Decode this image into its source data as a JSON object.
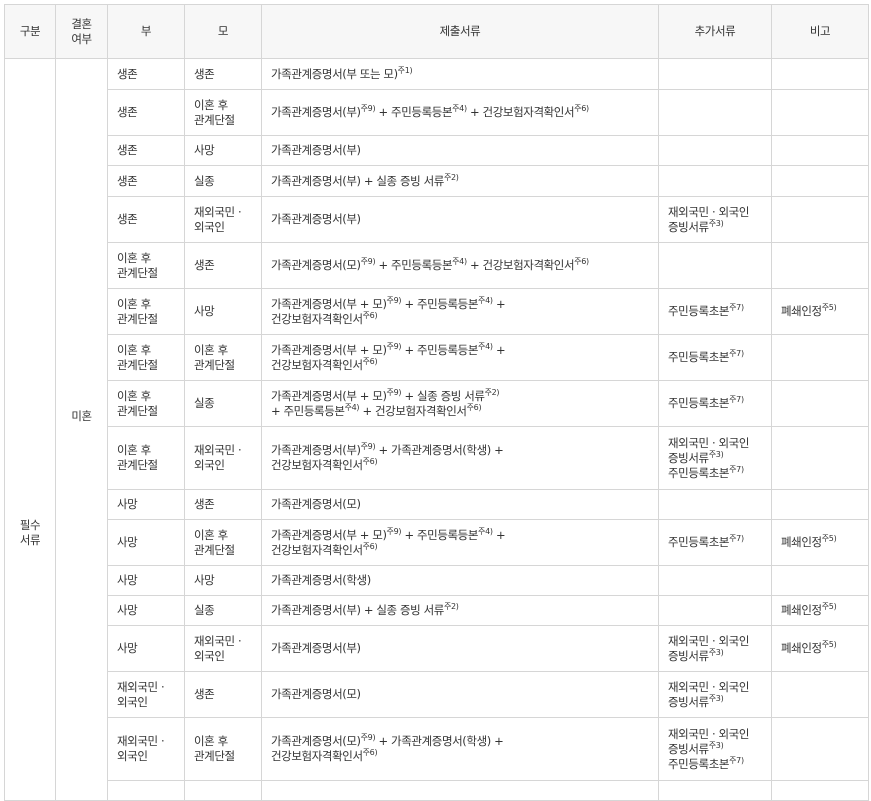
{
  "headers": [
    "구분",
    "결혼\n여부",
    "부",
    "모",
    "제출서류",
    "추가서류",
    "비고"
  ],
  "category": "필수\n서류",
  "marriage": "미혼",
  "rows": [
    {
      "father": "생존",
      "mother": "생존",
      "docs": [
        [
          "가족관계증명서(부 또는 모)"
        ],
        [
          "주1)",
          "s"
        ]
      ],
      "extra": [],
      "note": []
    },
    {
      "father": "생존",
      "mother": "이혼 후\n관계단절",
      "docs": [
        [
          "가족관계증명서(부)"
        ],
        [
          "주9)",
          "s"
        ],
        [
          " + 주민등록등본"
        ],
        [
          "주4)",
          "s"
        ],
        [
          " + 건강보험자격확인서"
        ],
        [
          "주6)",
          "s"
        ]
      ],
      "extra": [],
      "note": []
    },
    {
      "father": "생존",
      "mother": "사망",
      "docs": [
        [
          "가족관계증명서(부)"
        ]
      ],
      "extra": [],
      "note": []
    },
    {
      "father": "생존",
      "mother": "실종",
      "docs": [
        [
          "가족관계증명서(부) + 실종 증빙 서류"
        ],
        [
          "주2)",
          "s"
        ]
      ],
      "extra": [],
      "note": []
    },
    {
      "father": "생존",
      "mother": "재외국민 ·\n외국인",
      "docs": [
        [
          "가족관계증명서(부)"
        ]
      ],
      "extra": [
        [
          "재외국민 · 외국인\n증빙서류"
        ],
        [
          "주3)",
          "s"
        ]
      ],
      "note": []
    },
    {
      "father": "이혼 후\n관계단절",
      "mother": "생존",
      "docs": [
        [
          "가족관계증명서(모)"
        ],
        [
          "주9)",
          "s"
        ],
        [
          " + 주민등록등본"
        ],
        [
          "주4)",
          "s"
        ],
        [
          " + 건강보험자격확인서"
        ],
        [
          "주6)",
          "s"
        ]
      ],
      "extra": [],
      "note": []
    },
    {
      "father": "이혼 후\n관계단절",
      "mother": "사망",
      "docs": [
        [
          "가족관계증명서(부 + 모)"
        ],
        [
          "주9)",
          "s"
        ],
        [
          " + 주민등록등본"
        ],
        [
          "주4)",
          "s"
        ],
        [
          " +\n건강보험자격확인서"
        ],
        [
          "주6)",
          "s"
        ]
      ],
      "extra": [
        [
          "주민등록초본"
        ],
        [
          "주7)",
          "s"
        ]
      ],
      "note": [
        [
          "폐쇄인정"
        ],
        [
          "주5)",
          "s"
        ]
      ]
    },
    {
      "father": "이혼 후\n관계단절",
      "mother": "이혼 후\n관계단절",
      "docs": [
        [
          "가족관계증명서(부 + 모)"
        ],
        [
          "주9)",
          "s"
        ],
        [
          " + 주민등록등본"
        ],
        [
          "주4)",
          "s"
        ],
        [
          " +\n건강보험자격확인서"
        ],
        [
          "주6)",
          "s"
        ]
      ],
      "extra": [
        [
          "주민등록초본"
        ],
        [
          "주7)",
          "s"
        ]
      ],
      "note": []
    },
    {
      "father": "이혼 후\n관계단절",
      "mother": "실종",
      "docs": [
        [
          "가족관계증명서(부 + 모)"
        ],
        [
          "주9)",
          "s"
        ],
        [
          " + 실종 증빙 서류"
        ],
        [
          "주2)",
          "s"
        ],
        [
          "\n+ 주민등록등본"
        ],
        [
          "주4)",
          "s"
        ],
        [
          " + 건강보험자격확인서"
        ],
        [
          "주6)",
          "s"
        ]
      ],
      "extra": [
        [
          "주민등록초본"
        ],
        [
          "주7)",
          "s"
        ]
      ],
      "note": []
    },
    {
      "father": "이혼 후\n관계단절",
      "mother": "재외국민 ·\n외국인",
      "docs": [
        [
          "가족관계증명서(부)"
        ],
        [
          "주9)",
          "s"
        ],
        [
          " + 가족관계증명서(학생) +\n건강보험자격확인서"
        ],
        [
          "주6)",
          "s"
        ]
      ],
      "extra": [
        [
          "재외국민 · 외국인\n증빙서류"
        ],
        [
          "주3)",
          "s"
        ],
        [
          "\n주민등록초본"
        ],
        [
          "주7)",
          "s"
        ]
      ],
      "note": []
    },
    {
      "father": "사망",
      "mother": "생존",
      "docs": [
        [
          "가족관계증명서(모)"
        ]
      ],
      "extra": [],
      "note": []
    },
    {
      "father": "사망",
      "mother": "이혼 후\n관계단절",
      "docs": [
        [
          "가족관계증명서(부 + 모)"
        ],
        [
          "주9)",
          "s"
        ],
        [
          " + 주민등록등본"
        ],
        [
          "주4)",
          "s"
        ],
        [
          " +\n건강보험자격확인서"
        ],
        [
          "주6)",
          "s"
        ]
      ],
      "extra": [
        [
          "주민등록초본"
        ],
        [
          "주7)",
          "s"
        ]
      ],
      "note": [
        [
          "폐쇄인정"
        ],
        [
          "주5)",
          "s"
        ]
      ]
    },
    {
      "father": "사망",
      "mother": "사망",
      "docs": [
        [
          "가족관계증명서(학생)"
        ]
      ],
      "extra": [],
      "note": []
    },
    {
      "father": "사망",
      "mother": "실종",
      "docs": [
        [
          "가족관계증명서(부) + 실종 증빙 서류"
        ],
        [
          "주2)",
          "s"
        ]
      ],
      "extra": [],
      "note": [
        [
          "폐쇄인정"
        ],
        [
          "주5)",
          "s"
        ]
      ]
    },
    {
      "father": "사망",
      "mother": "재외국민 ·\n외국인",
      "docs": [
        [
          "가족관계증명서(부)"
        ]
      ],
      "extra": [
        [
          "재외국민 · 외국인\n증빙서류"
        ],
        [
          "주3)",
          "s"
        ]
      ],
      "note": [
        [
          "폐쇄인정"
        ],
        [
          "주5)",
          "s"
        ]
      ]
    },
    {
      "father": "재외국민 ·\n외국인",
      "mother": "생존",
      "docs": [
        [
          "가족관계증명서(모)"
        ]
      ],
      "extra": [
        [
          "재외국민 · 외국인\n증빙서류"
        ],
        [
          "주3)",
          "s"
        ]
      ],
      "note": []
    },
    {
      "father": "재외국민 ·\n외국인",
      "mother": "이혼 후\n관계단절",
      "docs": [
        [
          "가족관계증명서(모)"
        ],
        [
          "주9)",
          "s"
        ],
        [
          " + 가족관계증명서(학생) +\n건강보험자격확인서"
        ],
        [
          "주6)",
          "s"
        ]
      ],
      "extra": [
        [
          "재외국민 · 외국인\n증빙서류"
        ],
        [
          "주3)",
          "s"
        ],
        [
          "\n주민등록초본"
        ],
        [
          "주7)",
          "s"
        ]
      ],
      "note": []
    },
    {
      "father": "",
      "mother": "",
      "docs": [],
      "extra": [],
      "note": []
    }
  ]
}
